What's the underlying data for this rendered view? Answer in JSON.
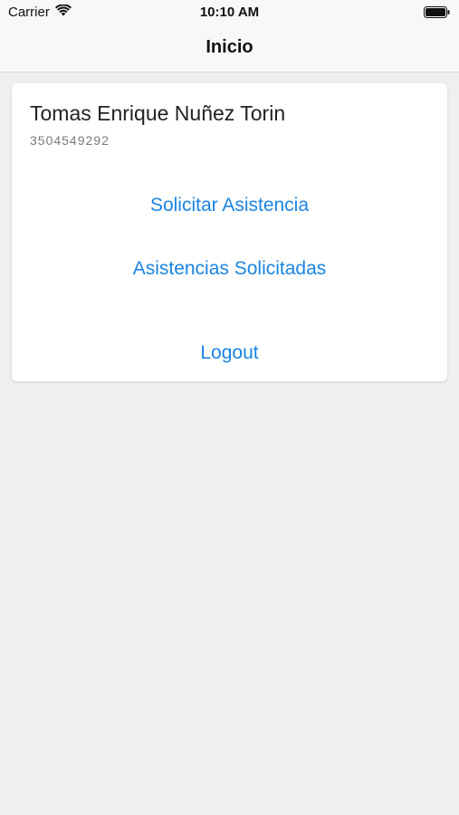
{
  "status_bar": {
    "carrier": "Carrier",
    "wifi_icon": "wifi-icon",
    "time": "10:10 AM",
    "battery_icon": "battery-icon"
  },
  "nav": {
    "title": "Inicio"
  },
  "profile": {
    "name": "Tomas Enrique Nuñez Torin",
    "phone": "3504549292"
  },
  "actions": {
    "solicitar_label": "Solicitar Asistencia",
    "asistencias_label": "Asistencias Solicitadas",
    "logout_label": "Logout"
  },
  "colors": {
    "accent": "#1a84e2",
    "background": "#efeff0",
    "card": "#ffffff"
  }
}
